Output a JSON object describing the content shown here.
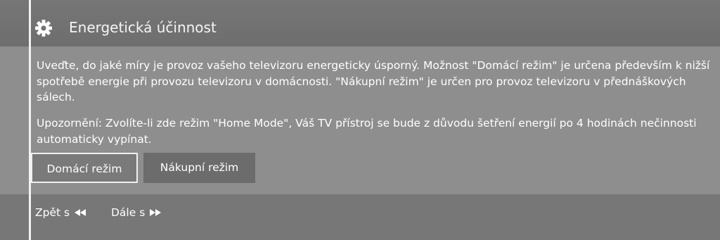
{
  "header": {
    "title": "Energetická účinnost",
    "icon": "gear-icon"
  },
  "content": {
    "paragraph1": "Uveďte, do jaké míry je provoz vašeho televizoru energeticky úsporný. Možnost \"Domácí režim\" je určena především k nižší spotřebě energie při provozu televizoru v domácnosti. \"Nákupní režim\" je určen pro provoz televizoru v přednáškových sálech.",
    "paragraph2": "Upozornění: Zvolíte-li zde režim \"Home Mode\", Váš TV přístroj se bude z důvodu šetření energií po 4 hodinách nečinnosti automaticky vypínat."
  },
  "options": {
    "home_label": "Domácí režim",
    "shop_label": "Nákupní režim",
    "selected": "Domácí režim"
  },
  "footer": {
    "back_label": "Zpět s",
    "back_icon": "rewind-icon",
    "next_label": "Dále s",
    "next_icon": "fast-forward-icon"
  },
  "colors": {
    "background": "#777777",
    "content_panel": "#8e8e8e",
    "text": "#ffffff",
    "selected_border": "#f0f0f0"
  }
}
